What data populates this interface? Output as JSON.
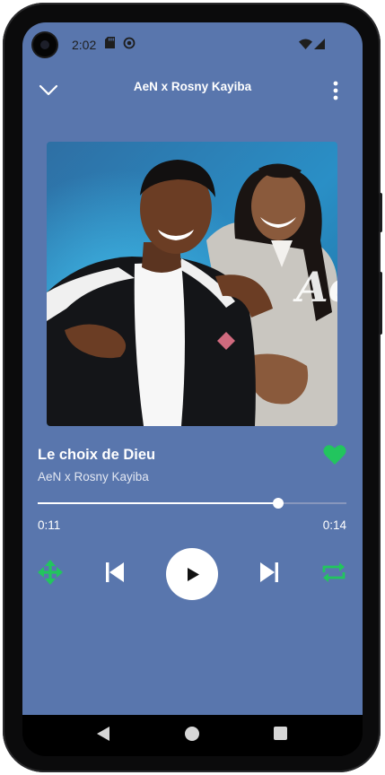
{
  "status_bar": {
    "time": "2:02"
  },
  "header": {
    "title": "AeN x Rosny Kayiba"
  },
  "artwork": {
    "logo_text": "Ae"
  },
  "track": {
    "title": "Le choix de Dieu",
    "artist": "AeN x Rosny Kayiba",
    "liked": true
  },
  "progress": {
    "current": "0:11",
    "duration": "0:14",
    "fraction": 0.78
  },
  "colors": {
    "background": "#5976ad",
    "accent_green": "#22c55e",
    "text": "#ffffff"
  },
  "icons": {
    "collapse": "chevron-down-icon",
    "more": "more-vertical-icon",
    "like": "heart-icon",
    "shuffle": "shuffle-arrows-icon",
    "previous": "skip-previous-icon",
    "play": "play-icon",
    "next": "skip-next-icon",
    "repeat": "repeat-icon"
  }
}
